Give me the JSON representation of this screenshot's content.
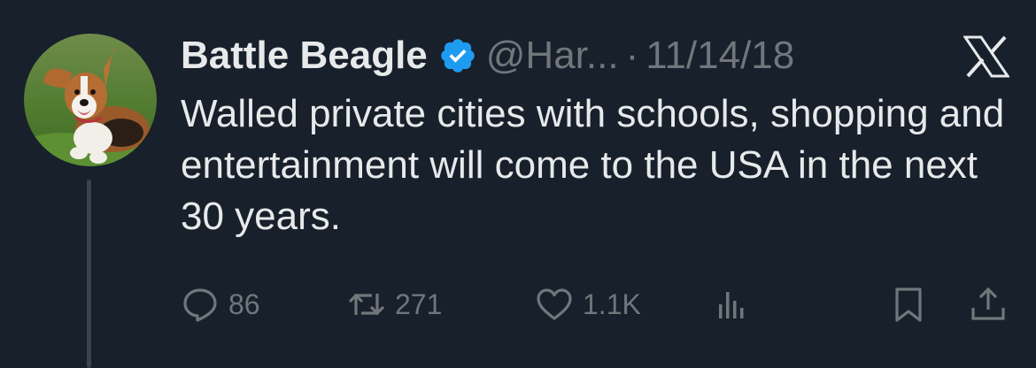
{
  "tweet": {
    "display_name": "Battle Beagle",
    "handle": "@Har...",
    "separator": "·",
    "date": "11/14/18",
    "text": "Walled private cities with schools, shopping and entertainment will come to the USA in the next 30 years.",
    "verified_icon": "verified-badge-icon",
    "verified_color": "#1d9bf0"
  },
  "actions": {
    "replies": "86",
    "reposts": "271",
    "likes": "1.1K"
  },
  "colors": {
    "background": "#17202b",
    "text": "#e7e9ea",
    "muted": "#71767b"
  }
}
